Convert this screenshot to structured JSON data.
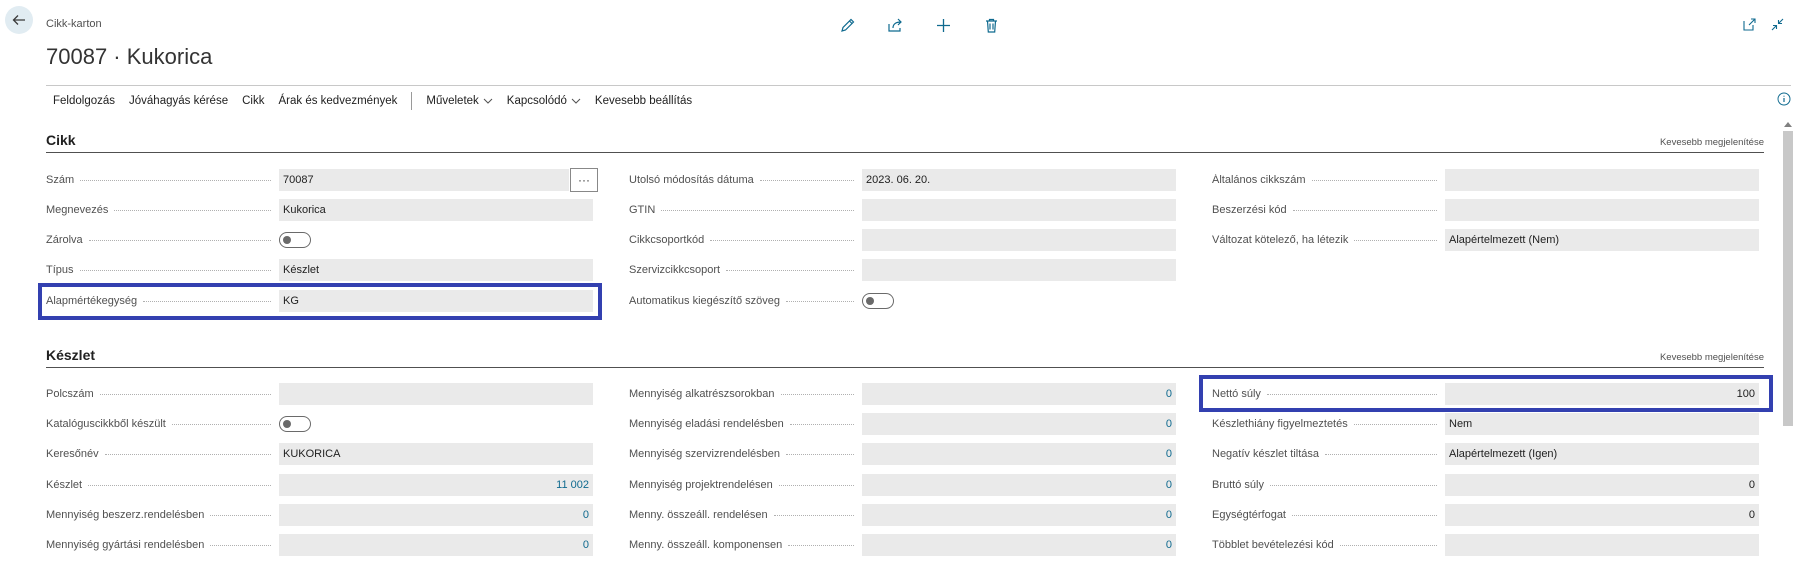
{
  "header": {
    "breadcrumb": "Cikk-karton",
    "title": "70087 · Kukorica"
  },
  "action_bar": {
    "items": [
      "Feldolgozás",
      "Jóváhagyás kérése",
      "Cikk",
      "Árak és kedvezmények"
    ],
    "menus": [
      "Műveletek",
      "Kapcsolódó"
    ],
    "less_options": "Kevesebb beállítás"
  },
  "section_item": {
    "title": "Cikk",
    "show_less": "Kevesebb megjelenítése",
    "col1": [
      {
        "label": "Szám",
        "value": "70087"
      },
      {
        "label": "Megnevezés",
        "value": "Kukorica"
      },
      {
        "label": "Zárolva",
        "value": "off"
      },
      {
        "label": "Típus",
        "value": "Készlet"
      },
      {
        "label": "Alapmértékegység",
        "value": "KG"
      }
    ],
    "col2": [
      {
        "label": "Utolsó módosítás dátuma",
        "value": "2023. 06. 20."
      },
      {
        "label": "GTIN",
        "value": ""
      },
      {
        "label": "Cikkcsoportkód",
        "value": ""
      },
      {
        "label": "Szervizcikkcsoport",
        "value": ""
      },
      {
        "label": "Automatikus kiegészítő szöveg",
        "value": "off"
      }
    ],
    "col3": [
      {
        "label": "Általános cikkszám",
        "value": ""
      },
      {
        "label": "Beszerzési kód",
        "value": ""
      },
      {
        "label": "Változat kötelező, ha létezik",
        "value": "Alapértelmezett (Nem)"
      }
    ],
    "lookup_label": "···"
  },
  "section_inventory": {
    "title": "Készlet",
    "show_less": "Kevesebb megjelenítése",
    "col1": [
      {
        "label": "Polcszám",
        "value": ""
      },
      {
        "label": "Katalóguscikkből készült",
        "value": "off"
      },
      {
        "label": "Keresőnév",
        "value": "KUKORICA"
      },
      {
        "label": "Készlet",
        "value": "11 002"
      },
      {
        "label": "Mennyiség beszerz.rendelésben",
        "value": "0"
      },
      {
        "label": "Mennyiség gyártási rendelésben",
        "value": "0"
      }
    ],
    "col2": [
      {
        "label": "Mennyiség alkatrészsorokban",
        "value": "0"
      },
      {
        "label": "Mennyiség eladási rendelésben",
        "value": "0"
      },
      {
        "label": "Mennyiség szervizrendelésben",
        "value": "0"
      },
      {
        "label": "Mennyiség projektrendelésen",
        "value": "0"
      },
      {
        "label": "Menny. összeáll. rendelésen",
        "value": "0"
      },
      {
        "label": "Menny. összeáll. komponensen",
        "value": "0"
      }
    ],
    "col3": [
      {
        "label": "Nettó súly",
        "value": "100"
      },
      {
        "label": "Készlethiány figyelmeztetés",
        "value": "Nem"
      },
      {
        "label": "Negatív készlet tiltása",
        "value": "Alapértelmezett (Igen)"
      },
      {
        "label": "Bruttó súly",
        "value": "0"
      },
      {
        "label": "Egységtérfogat",
        "value": "0"
      },
      {
        "label": "Többlet bevételezési kód",
        "value": ""
      }
    ]
  },
  "colors": {
    "highlight": "#3340b0",
    "accent": "#0f6a8f",
    "field_bg": "#eaeaea"
  }
}
